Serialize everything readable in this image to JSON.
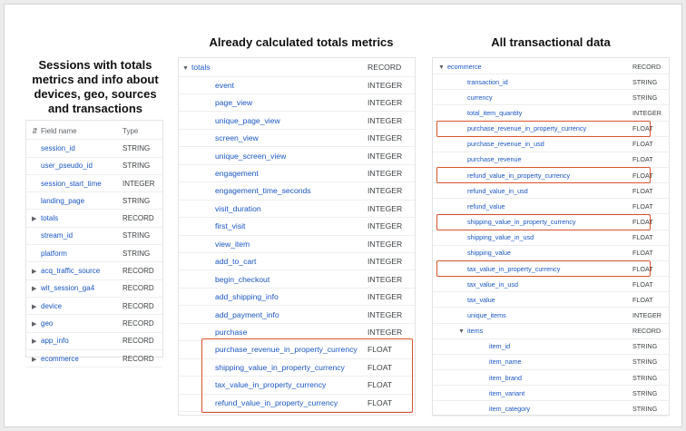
{
  "headings": {
    "left": "Sessions with totals metrics and info about devices, geo, sources and transactions",
    "middle": "Already calculated totals metrics",
    "right": "All transactional data"
  },
  "left_table": {
    "header": {
      "field": "Field name",
      "type": "Type"
    },
    "rows": [
      {
        "name": "session_id",
        "type": "STRING",
        "expandable": false
      },
      {
        "name": "user_pseudo_id",
        "type": "STRING",
        "expandable": false
      },
      {
        "name": "session_start_time",
        "type": "INTEGER",
        "expandable": false
      },
      {
        "name": "landing_page",
        "type": "STRING",
        "expandable": false
      },
      {
        "name": "totals",
        "type": "RECORD",
        "expandable": true
      },
      {
        "name": "stream_id",
        "type": "STRING",
        "expandable": false
      },
      {
        "name": "platform",
        "type": "STRING",
        "expandable": false
      },
      {
        "name": "acq_traffic_source",
        "type": "RECORD",
        "expandable": true
      },
      {
        "name": "wit_session_ga4",
        "type": "RECORD",
        "expandable": true
      },
      {
        "name": "device",
        "type": "RECORD",
        "expandable": true
      },
      {
        "name": "geo",
        "type": "RECORD",
        "expandable": true
      },
      {
        "name": "app_info",
        "type": "RECORD",
        "expandable": true
      },
      {
        "name": "ecommerce",
        "type": "RECORD",
        "expandable": true
      }
    ]
  },
  "middle_table": {
    "record": {
      "name": "totals",
      "type": "RECORD"
    },
    "rows": [
      {
        "name": "event",
        "type": "INTEGER"
      },
      {
        "name": "page_view",
        "type": "INTEGER"
      },
      {
        "name": "unique_page_view",
        "type": "INTEGER"
      },
      {
        "name": "screen_view",
        "type": "INTEGER"
      },
      {
        "name": "unique_screen_view",
        "type": "INTEGER"
      },
      {
        "name": "engagement",
        "type": "INTEGER"
      },
      {
        "name": "engagement_time_seconds",
        "type": "INTEGER"
      },
      {
        "name": "visit_duration",
        "type": "INTEGER"
      },
      {
        "name": "first_visit",
        "type": "INTEGER"
      },
      {
        "name": "view_item",
        "type": "INTEGER"
      },
      {
        "name": "add_to_cart",
        "type": "INTEGER"
      },
      {
        "name": "begin_checkout",
        "type": "INTEGER"
      },
      {
        "name": "add_shipping_info",
        "type": "INTEGER"
      },
      {
        "name": "add_payment_info",
        "type": "INTEGER"
      },
      {
        "name": "purchase",
        "type": "INTEGER"
      },
      {
        "name": "purchase_revenue_in_property_currency",
        "type": "FLOAT"
      },
      {
        "name": "shipping_value_in_property_currency",
        "type": "FLOAT"
      },
      {
        "name": "tax_value_in_property_currency",
        "type": "FLOAT"
      },
      {
        "name": "refund_value_in_property_currency",
        "type": "FLOAT"
      }
    ]
  },
  "right_table": {
    "record": {
      "name": "ecommerce",
      "type": "RECORD"
    },
    "rows": [
      {
        "name": "transaction_id",
        "type": "STRING"
      },
      {
        "name": "currency",
        "type": "STRING"
      },
      {
        "name": "total_item_quantity",
        "type": "INTEGER"
      },
      {
        "name": "purchase_revenue_in_property_currency",
        "type": "FLOAT"
      },
      {
        "name": "purchase_revenue_in_usd",
        "type": "FLOAT"
      },
      {
        "name": "purchase_revenue",
        "type": "FLOAT"
      },
      {
        "name": "refund_value_in_property_currency",
        "type": "FLOAT"
      },
      {
        "name": "refund_value_in_usd",
        "type": "FLOAT"
      },
      {
        "name": "refund_value",
        "type": "FLOAT"
      },
      {
        "name": "shipping_value_in_property_currency",
        "type": "FLOAT"
      },
      {
        "name": "shipping_value_in_usd",
        "type": "FLOAT"
      },
      {
        "name": "shipping_value",
        "type": "FLOAT"
      },
      {
        "name": "tax_value_in_property_currency",
        "type": "FLOAT"
      },
      {
        "name": "tax_value_in_usd",
        "type": "FLOAT"
      },
      {
        "name": "tax_value",
        "type": "FLOAT"
      },
      {
        "name": "unique_items",
        "type": "INTEGER"
      }
    ],
    "sub_record": {
      "name": "items",
      "type": "RECORD"
    },
    "sub_rows": [
      {
        "name": "item_id",
        "type": "STRING"
      },
      {
        "name": "item_name",
        "type": "STRING"
      },
      {
        "name": "item_brand",
        "type": "STRING"
      },
      {
        "name": "item_variant",
        "type": "STRING"
      },
      {
        "name": "item_category",
        "type": "STRING"
      }
    ]
  },
  "colors": {
    "link": "#1a56c4",
    "highlight": "#d9532c"
  },
  "icons": {
    "expand": "caret-right-icon",
    "expanded": "caret-down-icon",
    "sort": "sort-icon"
  }
}
